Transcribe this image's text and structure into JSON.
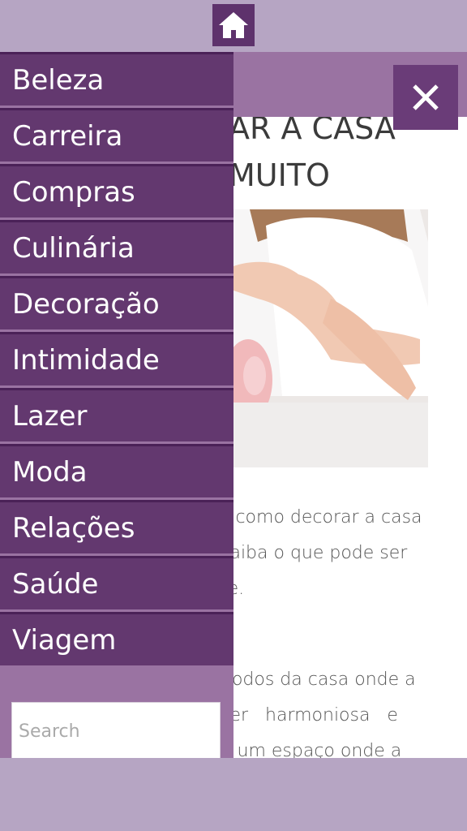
{
  "header": {
    "home_icon": "home-icon"
  },
  "close_icon": "close-icon",
  "colors": {
    "bar": "#b6a5c3",
    "sidebar": "#9a73a2",
    "menu_item": "#63386f",
    "menu_border": "#4a2157",
    "accent": "#5e326c"
  },
  "article": {
    "title_lines": [
      "AR A CASA",
      "MUITO"
    ],
    "paragraph1": [
      "s como decorar a casa",
      "saiba o que pode ser",
      "te."
    ],
    "paragraph2": [
      "nodos da casa onde a",
      "ser   harmoniosa   e",
      "é um espaço onde a"
    ]
  },
  "menu": {
    "items": [
      {
        "label": "Beleza"
      },
      {
        "label": "Carreira"
      },
      {
        "label": "Compras"
      },
      {
        "label": "Culinária"
      },
      {
        "label": "Decoração"
      },
      {
        "label": "Intimidade"
      },
      {
        "label": "Lazer"
      },
      {
        "label": "Moda"
      },
      {
        "label": "Relações"
      },
      {
        "label": "Saúde"
      },
      {
        "label": "Viagem"
      }
    ]
  },
  "search": {
    "placeholder": "Search"
  }
}
